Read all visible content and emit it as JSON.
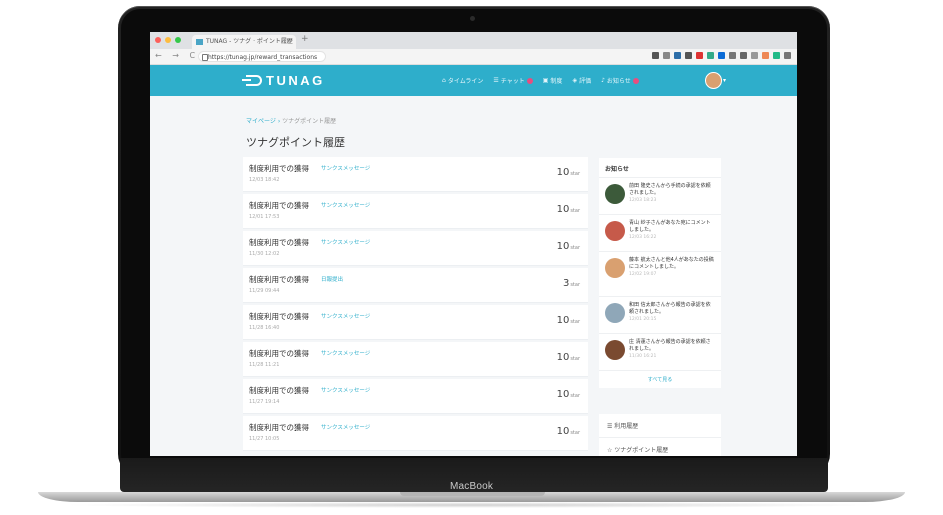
{
  "device": {
    "brand": "MacBook"
  },
  "browser": {
    "tab_title": "TUNAG - ツナグ · ポイント履歴",
    "tab_close": "×",
    "new_tab": "+",
    "nav_icons": "← → C",
    "url": "https://tunag.jp/reward_transactions"
  },
  "app": {
    "logo": "TUNAG",
    "nav": [
      {
        "label": "タイムライン"
      },
      {
        "label": "チャット"
      },
      {
        "label": "制度"
      },
      {
        "label": "評価"
      },
      {
        "label": "お知らせ"
      }
    ],
    "caret": "▾"
  },
  "page": {
    "breadcrumb_home": "マイページ",
    "breadcrumb_sep": "›",
    "breadcrumb_current": "ツナグポイント履歴",
    "title": "ツナグポイント履歴"
  },
  "rows": [
    {
      "label": "制度利用での獲得",
      "link": "サンクスメッセージ",
      "date": "12/03 18:42",
      "points": "10",
      "unit": "star"
    },
    {
      "label": "制度利用での獲得",
      "link": "サンクスメッセージ",
      "date": "12/01 17:53",
      "points": "10",
      "unit": "star"
    },
    {
      "label": "制度利用での獲得",
      "link": "サンクスメッセージ",
      "date": "11/30 12:02",
      "points": "10",
      "unit": "star"
    },
    {
      "label": "制度利用での獲得",
      "link": "日報提出",
      "date": "11/29 09:44",
      "points": "3",
      "unit": "star"
    },
    {
      "label": "制度利用での獲得",
      "link": "サンクスメッセージ",
      "date": "11/28 16:40",
      "points": "10",
      "unit": "star"
    },
    {
      "label": "制度利用での獲得",
      "link": "サンクスメッセージ",
      "date": "11/28 11:21",
      "points": "10",
      "unit": "star"
    },
    {
      "label": "制度利用での獲得",
      "link": "サンクスメッセージ",
      "date": "11/27 19:14",
      "points": "10",
      "unit": "star"
    },
    {
      "label": "制度利用での獲得",
      "link": "サンクスメッセージ",
      "date": "11/27 10:05",
      "points": "10",
      "unit": "star"
    }
  ],
  "sidebar": {
    "title": "お知らせ",
    "notices": [
      {
        "text": "前田 隆史さんから手続の承認を依頼されました。",
        "date": "12/03 18:23"
      },
      {
        "text": "青山 紗子さんがあなた宛にコメントしました。",
        "date": "12/03 16:22"
      },
      {
        "text": "藤本 航太さんと他4人があなたの投稿にコメントしました。",
        "date": "12/02 19:07"
      },
      {
        "text": "和田 信太郎さんから報告の承認を依頼されました。",
        "date": "12/01 20:15"
      },
      {
        "text": "庄 清蓮さんから報告の承認を依頼されました。",
        "date": "11/30 16:21"
      }
    ],
    "more": "すべて見る",
    "links": [
      {
        "label": "利用履歴"
      },
      {
        "label": "ツナグポイント履歴"
      }
    ]
  },
  "colors": {
    "accent": "#2eaecb",
    "badge": "#e84e7f"
  }
}
